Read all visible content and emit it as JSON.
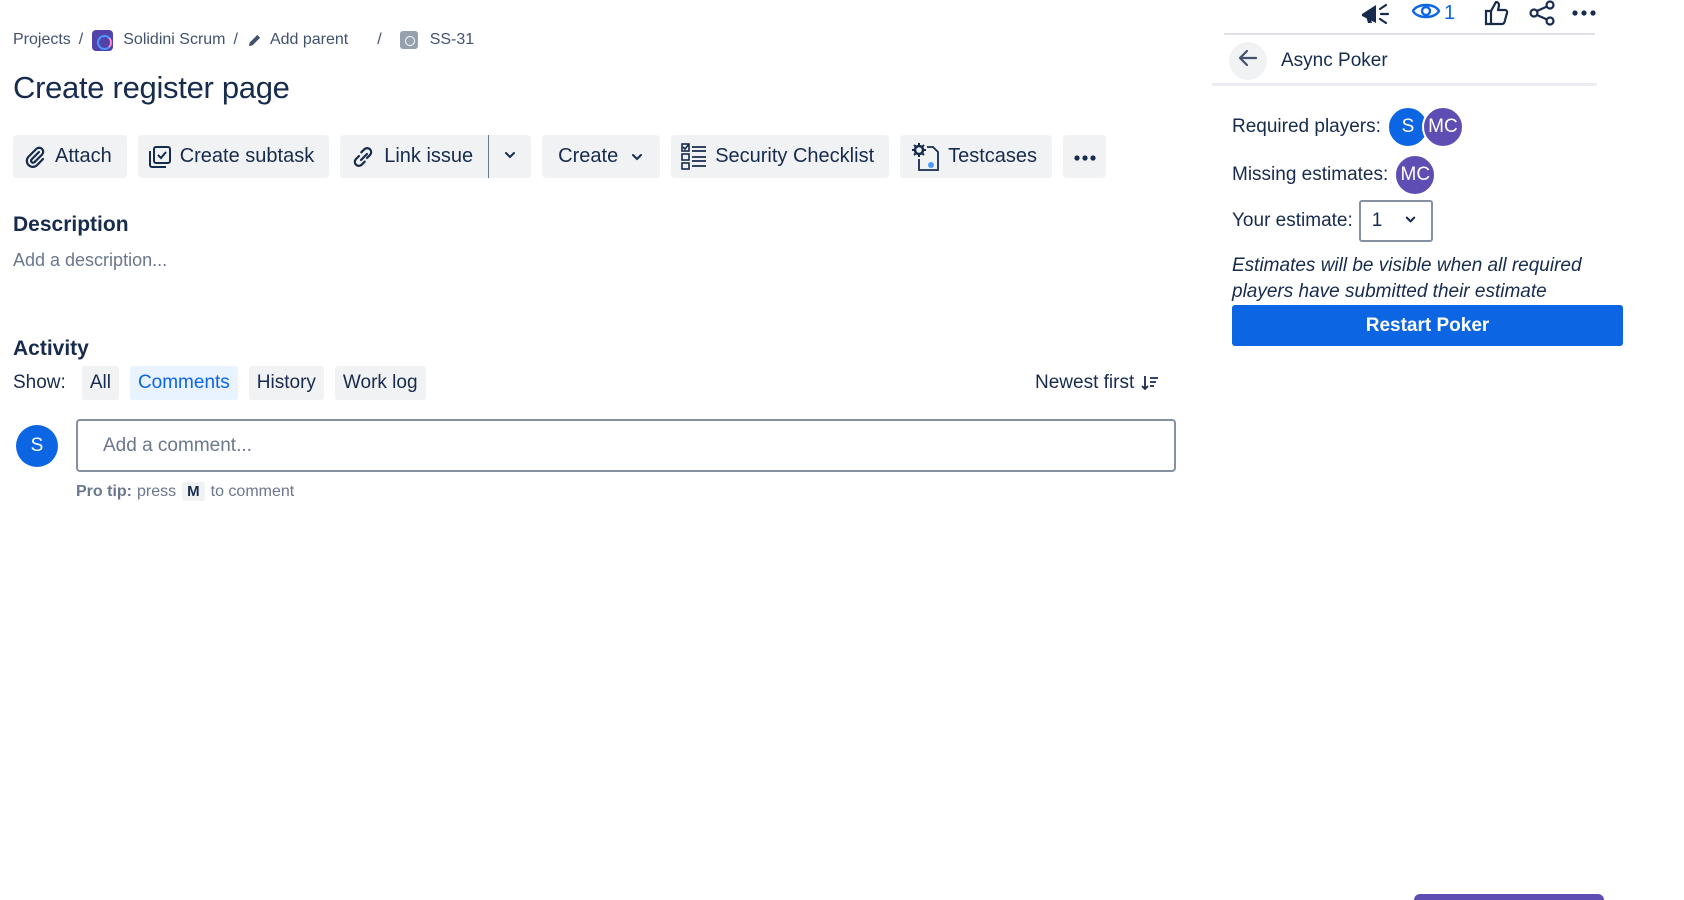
{
  "breadcrumb": {
    "projects": "Projects",
    "project": "Solidini Scrum",
    "add_parent": "Add parent",
    "issue_key": "SS-31",
    "separator": "/"
  },
  "issue": {
    "title": "Create register page"
  },
  "toolbar": {
    "attach": "Attach",
    "create_subtask": "Create subtask",
    "link_issue": "Link issue",
    "create": "Create",
    "security_checklist": "Security Checklist",
    "testcases": "Testcases"
  },
  "description": {
    "heading": "Description",
    "placeholder": "Add a description..."
  },
  "activity": {
    "heading": "Activity",
    "show_label": "Show:",
    "filters": [
      {
        "label": "All",
        "active": false
      },
      {
        "label": "Comments",
        "active": true
      },
      {
        "label": "History",
        "active": false
      },
      {
        "label": "Work log",
        "active": false
      }
    ],
    "sort": "Newest first",
    "avatar_initial": "S",
    "comment_placeholder": "Add a comment...",
    "pro_tip_label": "Pro tip:",
    "pro_tip_press": "press",
    "pro_tip_key": "M",
    "pro_tip_rest": "to comment"
  },
  "top_actions": {
    "watch_count": "1"
  },
  "poker": {
    "title": "Async Poker",
    "required_players_label": "Required players:",
    "required_players": [
      "S",
      "MC"
    ],
    "missing_estimates_label": "Missing estimates:",
    "missing_estimates": [
      "MC"
    ],
    "your_estimate_label": "Your estimate:",
    "your_estimate_value": "1",
    "note": "Estimates will be visible when all required players have submitted their estimate",
    "restart_label": "Restart Poker"
  },
  "colors": {
    "primary": "#0c66e4",
    "text": "#172b4d",
    "subtle": "#6b778c",
    "button_bg": "#f1f2f4",
    "avatar_purple": "#5e4db2"
  }
}
